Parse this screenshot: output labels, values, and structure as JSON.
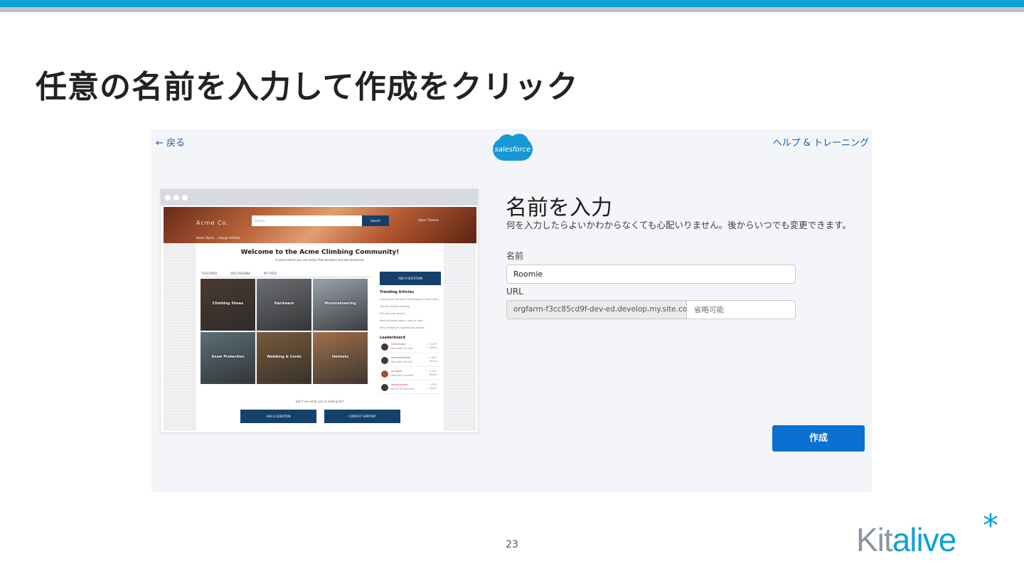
{
  "slide": {
    "title": "任意の名前を入力して作成をクリック",
    "page_number": "23",
    "brand": {
      "part1": "Kit",
      "part2": "alive",
      "mark": "*"
    }
  },
  "screen": {
    "back_link": "← 戻る",
    "help_link": "ヘルプ & トレーニング",
    "logo_text": "salesforce",
    "form": {
      "title": "名前を入力",
      "description": "何を入力したらよいかわからなくても心配いりません。後からいつでも変更できます。",
      "name_label": "名前",
      "name_value": "Roomie",
      "url_label": "URL",
      "url_prefix": "orgfarm-f3cc85cd9f-dev-ed.develop.my.site.co...",
      "url_placeholder": "省略可能",
      "create_button": "作成"
    },
    "preview": {
      "site_name": "Acme Co.",
      "search_placeholder": "Search...",
      "search_button": "Search",
      "user_name": "Aaron Thomas",
      "nav": "Home   Topics ⌄   Groups   Articles",
      "welcome": "Welcome to the Acme Climbing Community!",
      "subtitle": "A place where you can easily find solutions and ask questions.",
      "tabs": [
        "FEATURED",
        "DISCUSSIONS",
        "MY FEED"
      ],
      "tiles": [
        {
          "label": "Climbing Shoes",
          "color": "#4a3a30"
        },
        {
          "label": "Hardware",
          "color": "#6b6e73"
        },
        {
          "label": "Mountaineering",
          "color": "#9aa3ad"
        },
        {
          "label": "Snow Protection",
          "color": "#5c6e78"
        },
        {
          "label": "Webbing & Cords",
          "color": "#7a5a3a"
        },
        {
          "label": "Helmets",
          "color": "#a0704a"
        }
      ],
      "ask_button": "ASK A QUESTION",
      "trending_heading": "Trending Articles",
      "trending": [
        "Lessons for first-time climbing gym community",
        "Tips for limited climbing",
        "DIY (dos and don'ts)",
        "Rock climbing basics, step by step",
        "Why climbing is a great kids activity"
      ],
      "leaderboard_heading": "Leaderboard",
      "leaders": [
        {
          "name": "markclimbs",
          "rank": "Mountain VR Star",
          "points": "5,209",
          "unit": "Points"
        },
        {
          "name": "mountainjunkie",
          "rank": "Mountain VR Star",
          "points": "3,650",
          "unit": "Points"
        },
        {
          "name": "jumpand",
          "rank": "Mountain Explorer",
          "points": "2,941",
          "unit": "Points"
        },
        {
          "name": "wellstraveled",
          "rank": "Rocky Mountaineer",
          "points": "1,529",
          "unit": "Points"
        }
      ],
      "cant_find": "Don't see what you're looking for?",
      "bottom_ask": "ASK A QUESTION",
      "bottom_contact": "CONTACT SUPPORT"
    }
  }
}
